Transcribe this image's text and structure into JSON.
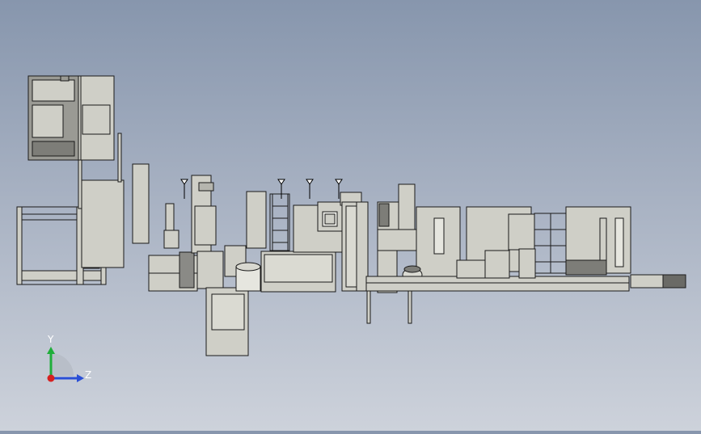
{
  "viewport": {
    "background_top": "#8796ad",
    "background_bottom": "#cdd2db",
    "part_fill": "#cfcfc7",
    "part_fill_dark": "#9a9a94",
    "part_stroke": "#1a1a1a"
  },
  "triad": {
    "y_label": "Y",
    "z_label": "Z",
    "y_color": "#1fae3a",
    "z_color": "#2a4fd6",
    "x_color": "#d62020",
    "origin_color": "#d62020"
  }
}
